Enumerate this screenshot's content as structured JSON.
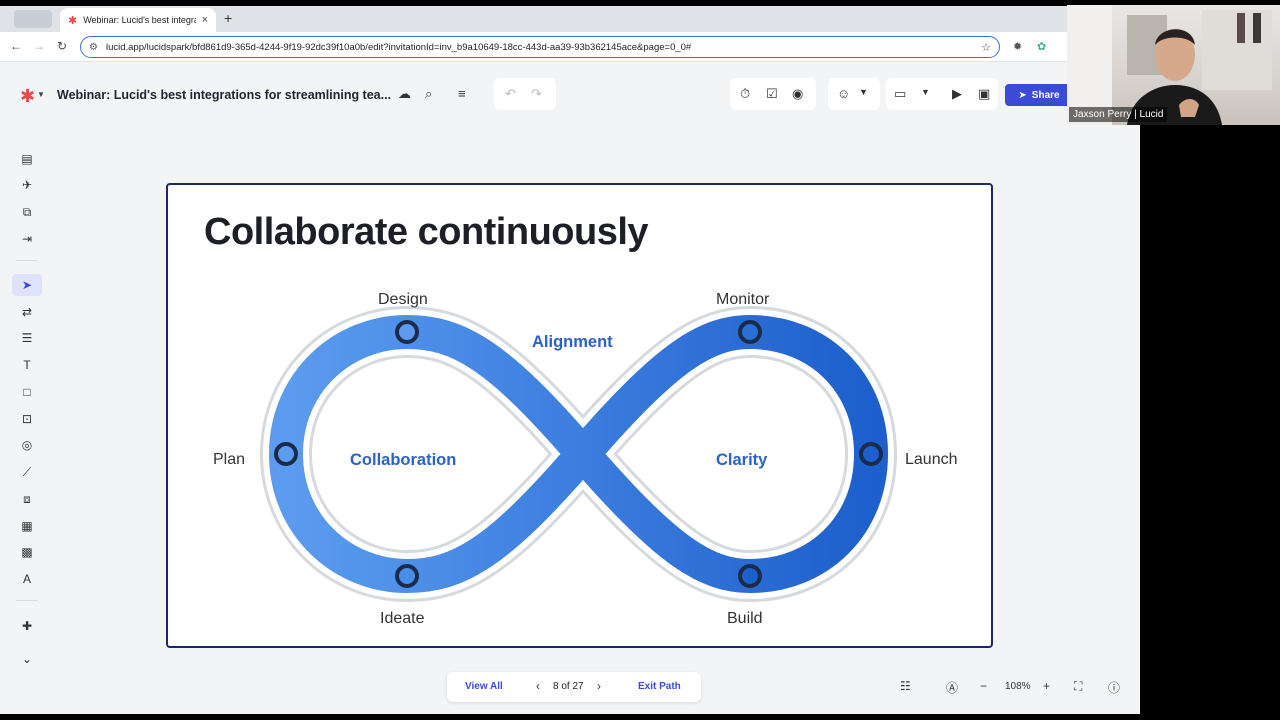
{
  "browser": {
    "tab_title": "Webinar: Lucid's best integra",
    "tab_close": "×",
    "new_tab": "+",
    "url": "lucid.app/lucidspark/bfd861d9-365d-4244-9f19-92dc39f10a0b/edit?invitationId=inv_b9a10649-18cc-443d-aa39-93b362145ace&page=0_0#"
  },
  "toolbar": {
    "doc_title": "Webinar: Lucid's best integrations for streamlining tea...",
    "share_label": "Share"
  },
  "slide": {
    "title": "Collaborate continuously",
    "labels": {
      "design": "Design",
      "monitor": "Monitor",
      "plan": "Plan",
      "launch": "Launch",
      "ideate": "Ideate",
      "build": "Build",
      "alignment": "Alignment",
      "collaboration": "Collaboration",
      "clarity": "Clarity"
    }
  },
  "path_nav": {
    "view_all": "View All",
    "position": "8 of 27",
    "exit": "Exit Path"
  },
  "zoom": {
    "level": "108%"
  },
  "webcam": {
    "name": "Jaxson Perry | Lucid"
  },
  "colors": {
    "accent": "#3c4bd6",
    "loop_light": "#5b9cf0",
    "loop_dark": "#1d5fcc",
    "slide_border": "#1e2670",
    "label_blue": "#2a62c9"
  }
}
